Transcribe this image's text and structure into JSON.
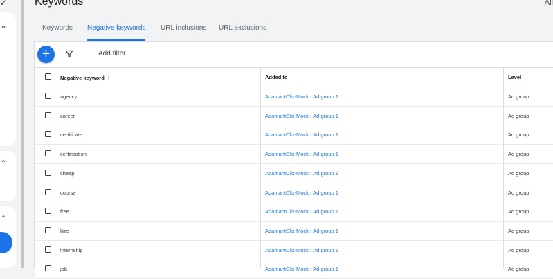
{
  "page": {
    "title": "Keywords",
    "top_right": "All"
  },
  "tabs": [
    {
      "label": "Keywords"
    },
    {
      "label": "Negative keywords"
    },
    {
      "label": "URL inclusions"
    },
    {
      "label": "URL exclusions"
    }
  ],
  "toolbar": {
    "add_filter_label": "Add filter"
  },
  "table": {
    "headers": {
      "keyword": "Negative keyword",
      "added_to": "Added to",
      "level": "Level"
    },
    "rows": [
      {
        "keyword": "agency",
        "added_to": "AdamantClix-Mock › Ad group 1",
        "level": "Ad group"
      },
      {
        "keyword": "career",
        "added_to": "AdamantClix-Mock › Ad group 1",
        "level": "Ad group"
      },
      {
        "keyword": "certificate",
        "added_to": "AdamantClix-Mock › Ad group 1",
        "level": "Ad group"
      },
      {
        "keyword": "certification",
        "added_to": "AdamantClix-Mock › Ad group 1",
        "level": "Ad group"
      },
      {
        "keyword": "cheap",
        "added_to": "AdamantClix-Mock › Ad group 1",
        "level": "Ad group"
      },
      {
        "keyword": "course",
        "added_to": "AdamantClix-Mock › Ad group 1",
        "level": "Ad group"
      },
      {
        "keyword": "free",
        "added_to": "AdamantClix-Mock › Ad group 1",
        "level": "Ad group"
      },
      {
        "keyword": "hire",
        "added_to": "AdamantClix-Mock › Ad group 1",
        "level": "Ad group"
      },
      {
        "keyword": "internship",
        "added_to": "AdamantClix-Mock › Ad group 1",
        "level": "Ad group"
      },
      {
        "keyword": "job",
        "added_to": "AdamantClix-Mock › Ad group 1",
        "level": "Ad group"
      }
    ]
  },
  "colors": {
    "accent": "#1a73e8",
    "text": "#3c4043",
    "divider": "#dadce0"
  }
}
